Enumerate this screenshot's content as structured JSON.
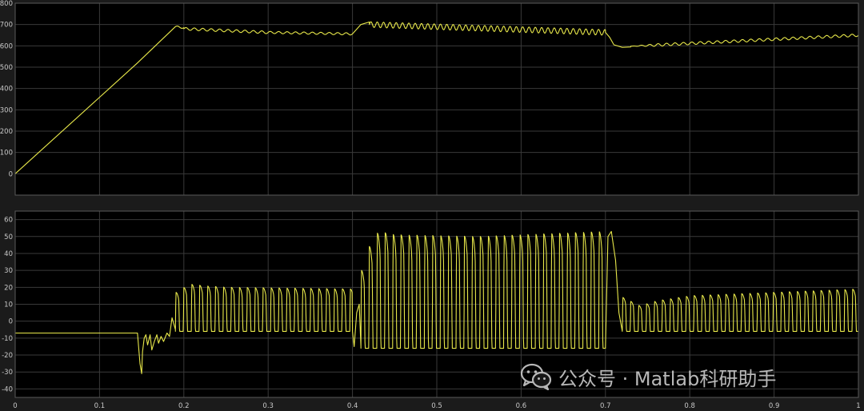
{
  "watermark": {
    "text": "公众号 · Matlab科研助手",
    "icon": "wechat-icon"
  },
  "colors": {
    "background": "#000000",
    "figure": "#1b1b1b",
    "grid": "#3a3a3a",
    "frame": "#5a5a5a",
    "trace": "#e8e84a",
    "tick_text": "#c8c8c8"
  },
  "chart_data": [
    {
      "type": "line",
      "title": "",
      "xlabel": "",
      "ylabel": "",
      "xlim": [
        0,
        1
      ],
      "ylim": [
        -100,
        800
      ],
      "grid": true,
      "x_ticks": [
        0,
        0.1,
        0.2,
        0.3,
        0.4,
        0.5,
        0.6,
        0.7,
        0.8,
        0.9,
        1
      ],
      "y_ticks": [
        0,
        100,
        200,
        300,
        400,
        500,
        600,
        700,
        800
      ],
      "y_tick_labels": [
        "0",
        "100",
        "200",
        "300",
        "400",
        "500",
        "600",
        "700",
        "800"
      ],
      "series": [
        {
          "segments": [
            {
              "kind": "line",
              "x": [
                0,
                0.145,
                0.19
              ],
              "y": [
                0,
                520,
                690
              ]
            },
            {
              "kind": "ripple",
              "x0": 0.19,
              "x1": 0.2,
              "base_start": 690,
              "base_end": 685,
              "amplitude": 4,
              "period": 0.01
            },
            {
              "kind": "ripple",
              "x0": 0.2,
              "x1": 0.3,
              "base_start": 680,
              "base_end": 663,
              "amplitude": 6,
              "period": 0.01
            },
            {
              "kind": "ripple",
              "x0": 0.3,
              "x1": 0.4,
              "base_start": 663,
              "base_end": 656,
              "amplitude": 5,
              "period": 0.01
            },
            {
              "kind": "line",
              "x": [
                0.4,
                0.41,
                0.42
              ],
              "y": [
                656,
                700,
                712
              ]
            },
            {
              "kind": "ripple",
              "x0": 0.42,
              "x1": 0.7,
              "base_start": 700,
              "base_end": 663,
              "amplitude": 13,
              "period": 0.0075
            },
            {
              "kind": "line",
              "x": [
                0.7,
                0.705,
                0.71,
                0.72,
                0.73
              ],
              "y": [
                663,
                640,
                605,
                593,
                595
              ]
            },
            {
              "kind": "ripple",
              "x0": 0.73,
              "x1": 1.0,
              "base_start": 598,
              "base_end": 650,
              "amplitude": 6,
              "period": 0.01,
              "settle": 0.03
            }
          ]
        }
      ]
    },
    {
      "type": "line",
      "title": "",
      "xlabel": "",
      "ylabel": "",
      "xlim": [
        0,
        1
      ],
      "ylim": [
        -45,
        65
      ],
      "grid": true,
      "x_ticks": [
        0,
        0.1,
        0.2,
        0.3,
        0.4,
        0.5,
        0.6,
        0.7,
        0.8,
        0.9,
        1
      ],
      "x_tick_labels": [
        "0",
        "0.1",
        "0.2",
        "0.3",
        "0.4",
        "0.5",
        "0.6",
        "0.7",
        "0.8",
        "0.9",
        "1"
      ],
      "y_ticks": [
        -40,
        -30,
        -20,
        -10,
        0,
        10,
        20,
        30,
        40,
        50,
        60
      ],
      "y_tick_labels": [
        "-40",
        "-30",
        "-20",
        "-10",
        "0",
        "10",
        "20",
        "30",
        "40",
        "50",
        "60"
      ],
      "series": [
        {
          "segments": [
            {
              "kind": "flat",
              "x0": 0,
              "x1": 0.145,
              "y": -7
            },
            {
              "kind": "line",
              "x": [
                0.145,
                0.148,
                0.15,
                0.151,
                0.153,
                0.155,
                0.157,
                0.16,
                0.162,
                0.165,
                0.168,
                0.17,
                0.173,
                0.176,
                0.18,
                0.183,
                0.186,
                0.19
              ],
              "y": [
                -7,
                -25,
                -31,
                -18,
                -10,
                -8,
                -14,
                -8,
                -17,
                -12,
                -8,
                -13,
                -9,
                -12,
                -7,
                -9,
                2,
                -5
              ]
            },
            {
              "kind": "pulses",
              "x0": 0.19,
              "x1": 0.4,
              "period": 0.0094,
              "low": -6,
              "peaks": [
                {
                  "x": 0.19,
                  "y": 17
                },
                {
                  "x": 0.2,
                  "y": 20
                },
                {
                  "x": 0.21,
                  "y": 22
                },
                {
                  "x": 0.22,
                  "y": 21
                },
                {
                  "x": 0.25,
                  "y": 20
                },
                {
                  "x": 0.4,
                  "y": 19
                }
              ]
            },
            {
              "kind": "line",
              "x": [
                0.4,
                0.402,
                0.405,
                0.408,
                0.41
              ],
              "y": [
                -6,
                -15,
                5,
                10,
                -15
              ]
            },
            {
              "kind": "pulses",
              "x0": 0.41,
              "x1": 0.7,
              "period": 0.0094,
              "low": -16,
              "peaks": [
                {
                  "x": 0.41,
                  "y": 30
                },
                {
                  "x": 0.42,
                  "y": 45
                },
                {
                  "x": 0.43,
                  "y": 53
                },
                {
                  "x": 0.45,
                  "y": 51
                },
                {
                  "x": 0.55,
                  "y": 50
                },
                {
                  "x": 0.7,
                  "y": 53
                }
              ]
            },
            {
              "kind": "line",
              "x": [
                0.7,
                0.703,
                0.707,
                0.712,
                0.716,
                0.72
              ],
              "y": [
                -16,
                50,
                53,
                36,
                5,
                -6
              ]
            },
            {
              "kind": "pulses",
              "x0": 0.72,
              "x1": 1.0,
              "period": 0.0094,
              "low": -6,
              "peaks": [
                {
                  "x": 0.72,
                  "y": 14
                },
                {
                  "x": 0.74,
                  "y": 9
                },
                {
                  "x": 0.76,
                  "y": 12
                },
                {
                  "x": 0.8,
                  "y": 15
                },
                {
                  "x": 1.0,
                  "y": 19
                }
              ]
            }
          ]
        }
      ]
    }
  ]
}
